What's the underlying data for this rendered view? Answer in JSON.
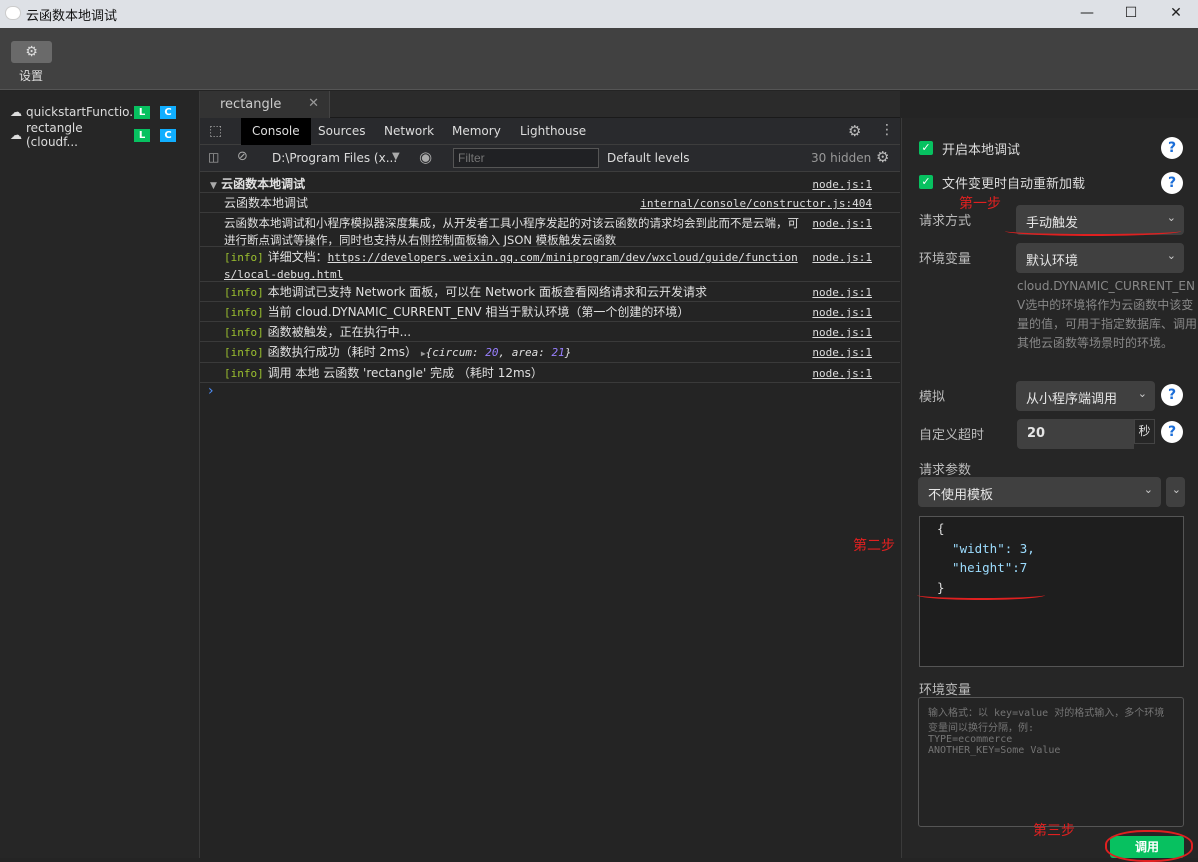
{
  "window": {
    "title": "云函数本地调试",
    "controls": [
      "minimize",
      "maximize",
      "close"
    ]
  },
  "toolbar": {
    "settings_label": "设置",
    "settings_icon": "gear-icon"
  },
  "sidebar": {
    "functions": [
      {
        "name": "quickstartFunctio...",
        "badges": [
          "L",
          "C"
        ]
      },
      {
        "name": "rectangle (cloudf...",
        "badges": [
          "L",
          "C"
        ]
      }
    ],
    "badge_colors": {
      "L": "#07c160",
      "C": "#10aeff"
    }
  },
  "editor_tab": {
    "label": "rectangle"
  },
  "devtools": {
    "tabs": [
      "Console",
      "Sources",
      "Network",
      "Memory",
      "Lighthouse"
    ],
    "active_tab": "Console",
    "context": "D:\\Program Files (x...",
    "filter_placeholder": "Filter",
    "levels": "Default levels",
    "hidden": "30 hidden"
  },
  "console": {
    "group_title": "云函数本地调试",
    "group_src": "node.js:1",
    "rows": [
      {
        "text": "云函数本地调试",
        "src": "internal/console/constructor.js:404"
      },
      {
        "text": "云函数本地调试和小程序模拟器深度集成，从开发者工具小程序发起的对该云函数的请求均会到此而不是云端，可进行断点调试等操作，同时也支持从右侧控制面板输入 JSON 模板触发云函数",
        "src": "node.js:1"
      },
      {
        "tag": "[info]",
        "text": "详细文档：",
        "link": "https://developers.weixin.qq.com/miniprogram/dev/wxcloud/guide/functions/local-debug.html",
        "src": "node.js:1"
      },
      {
        "tag": "[info]",
        "text": "本地调试已支持 Network 面板，可以在 Network 面板查看网络请求和云开发请求",
        "src": "node.js:1"
      },
      {
        "tag": "[info]",
        "text": "当前 cloud.DYNAMIC_CURRENT_ENV 相当于默认环境（第一个创建的环境）",
        "src": "node.js:1"
      },
      {
        "tag": "[info]",
        "text": "函数被触发，正在执行中...",
        "src": "node.js:1"
      },
      {
        "tag": "[info]",
        "text": "函数执行成功（耗时 2ms）",
        "obj_k1": "circum",
        "obj_v1": "20",
        "obj_k2": "area",
        "obj_v2": "21",
        "src": "node.js:1"
      },
      {
        "tag": "[info]",
        "text": "调用 本地 云函数 'rectangle' 完成  （耗时 12ms）",
        "src": "node.js:1"
      }
    ],
    "prompt": "›"
  },
  "panel": {
    "enable_local_debug": {
      "label": "开启本地调试",
      "checked": true
    },
    "auto_reload": {
      "label": "文件变更时自动重新加载",
      "checked": true
    },
    "request_mode": {
      "label": "请求方式",
      "value": "手动触发"
    },
    "env": {
      "label": "环境变量",
      "value": "默认环境",
      "help": "cloud.DYNAMIC_CURRENT_ENV选中的环境将作为云函数中该变量的值，可用于指定数据库、调用其他云函数等场景时的环境。"
    },
    "simulate": {
      "label": "模拟",
      "value": "从小程序端调用"
    },
    "timeout": {
      "label": "自定义超时",
      "value": "20",
      "unit": "秒"
    },
    "params": {
      "label": "请求参数",
      "template": "不使用模板",
      "json_lines": [
        "{",
        "  \"width\": 3,",
        "  \"height\":7",
        "}"
      ]
    },
    "env_vars": {
      "label": "环境变量",
      "placeholder": "输入格式：以 key=value 对的格式输入，多个环境变量间以换行分隔，例:\nTYPE=ecommerce\nANOTHER_KEY=Some Value"
    },
    "invoke_label": "调用",
    "accent": "#07c160"
  },
  "annotations": {
    "step1": "第一步",
    "step2": "第二步",
    "step3": "第三步",
    "color": "#e02020"
  }
}
